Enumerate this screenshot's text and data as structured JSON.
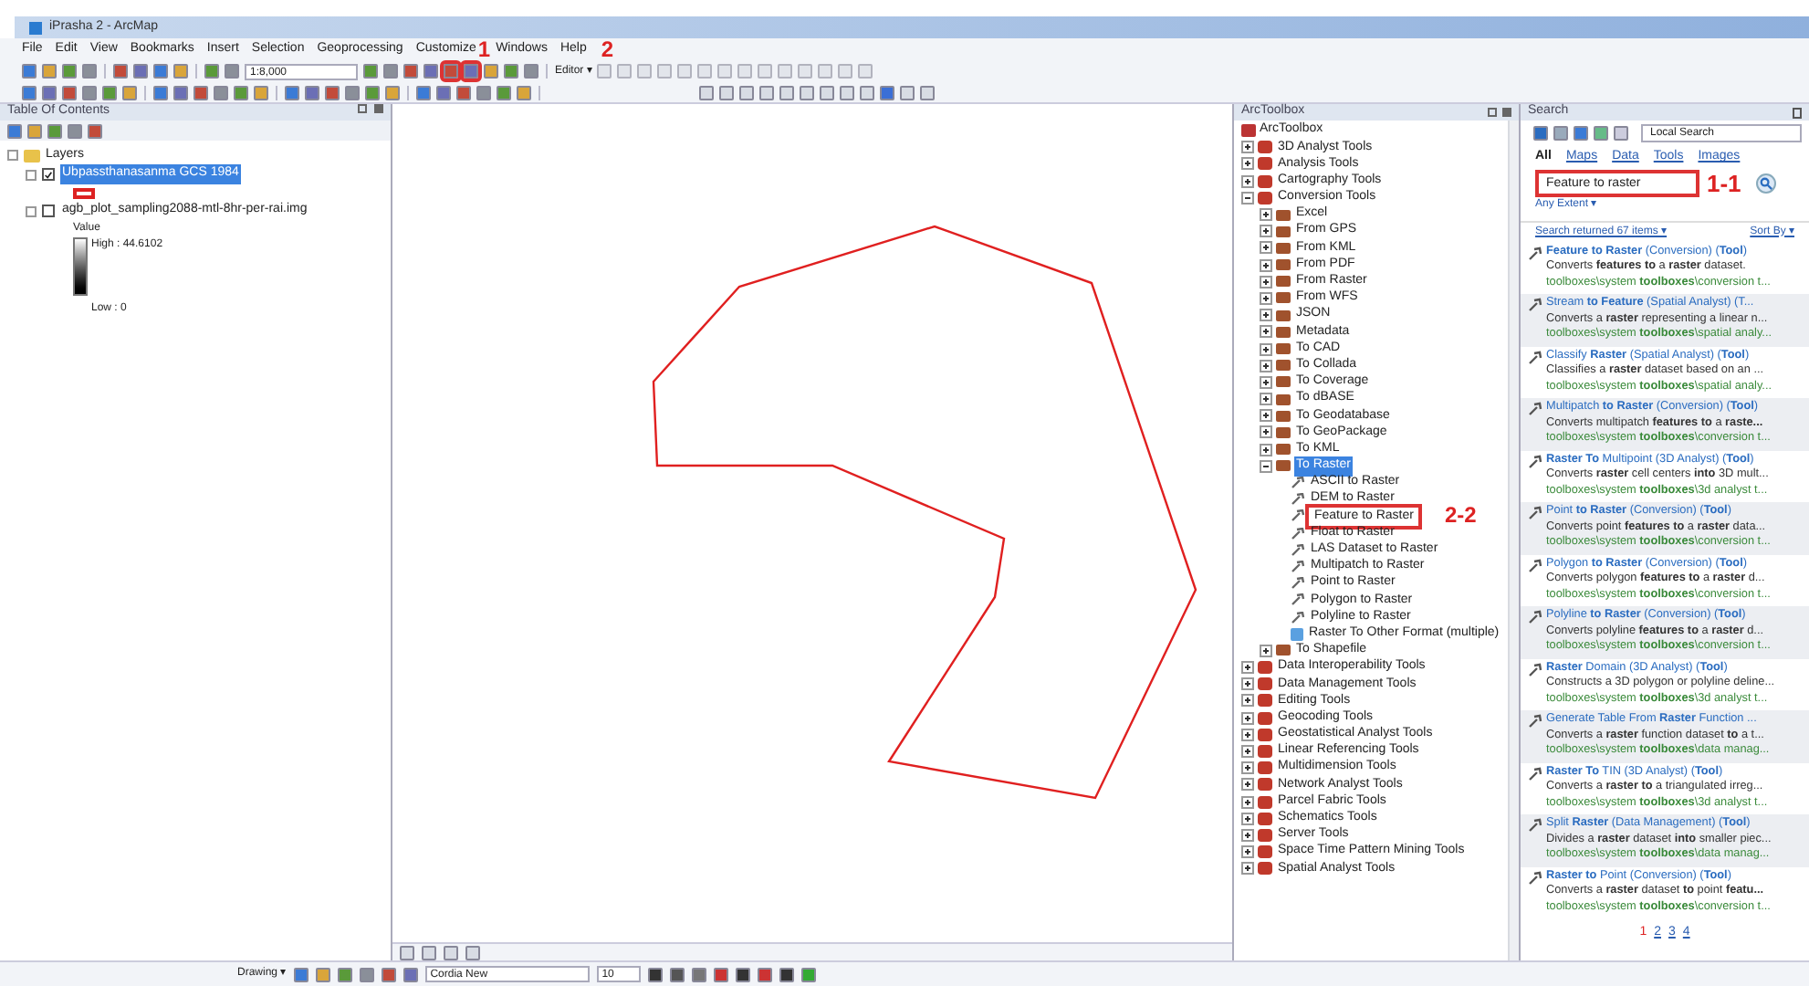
{
  "window": {
    "title": "iPrasha 2 - ArcMap"
  },
  "menu": [
    {
      "label": "File"
    },
    {
      "label": "Edit"
    },
    {
      "label": "View"
    },
    {
      "label": "Bookmarks"
    },
    {
      "label": "Insert"
    },
    {
      "label": "Selection"
    },
    {
      "label": "Geoprocessing"
    },
    {
      "label": "Customize"
    },
    {
      "label": "Windows"
    },
    {
      "label": "Help"
    }
  ],
  "toolbar": {
    "scale": "1:8,000",
    "editor": "Editor ▾"
  },
  "annotations": [
    {
      "text": "1"
    },
    {
      "text": "2"
    },
    {
      "text": "1-1"
    },
    {
      "text": "2-2"
    }
  ],
  "toc": {
    "title": "Table Of Contents",
    "root": "Layers",
    "layers": [
      {
        "name": "Ubpassthanasanma GCS 1984",
        "checked": true,
        "selected": true,
        "kind": "polygon"
      },
      {
        "name": "agb_plot_sampling2088-mtl-8hr-per-rai.img",
        "checked": false,
        "selected": false,
        "kind": "raster",
        "legend_title": "Value",
        "high": "High : 44.6102",
        "low": "Low : 0"
      }
    ]
  },
  "arctoolbox": {
    "title": "ArcToolbox",
    "root": "ArcToolbox",
    "items": [
      {
        "label": "3D Analyst Tools",
        "kind": "toolbox",
        "expanded": false,
        "selected": false
      },
      {
        "label": "Analysis Tools",
        "kind": "toolbox",
        "expanded": false,
        "selected": false
      },
      {
        "label": "Cartography Tools",
        "kind": "toolbox",
        "expanded": false,
        "selected": false
      },
      {
        "label": "Conversion Tools",
        "kind": "toolbox",
        "expanded": true,
        "selected": false,
        "children": [
          {
            "label": "Excel",
            "kind": "toolset",
            "expanded": false,
            "selected": false
          },
          {
            "label": "From GPS",
            "kind": "toolset",
            "expanded": false,
            "selected": false
          },
          {
            "label": "From KML",
            "kind": "toolset",
            "expanded": false,
            "selected": false
          },
          {
            "label": "From PDF",
            "kind": "toolset",
            "expanded": false,
            "selected": false
          },
          {
            "label": "From Raster",
            "kind": "toolset",
            "expanded": false,
            "selected": false
          },
          {
            "label": "From WFS",
            "kind": "toolset",
            "expanded": false,
            "selected": false
          },
          {
            "label": "JSON",
            "kind": "toolset",
            "expanded": false,
            "selected": false
          },
          {
            "label": "Metadata",
            "kind": "toolset",
            "expanded": false,
            "selected": false
          },
          {
            "label": "To CAD",
            "kind": "toolset",
            "expanded": false,
            "selected": false
          },
          {
            "label": "To Collada",
            "kind": "toolset",
            "expanded": false,
            "selected": false
          },
          {
            "label": "To Coverage",
            "kind": "toolset",
            "expanded": false,
            "selected": false
          },
          {
            "label": "To dBASE",
            "kind": "toolset",
            "expanded": false,
            "selected": false
          },
          {
            "label": "To Geodatabase",
            "kind": "toolset",
            "expanded": false,
            "selected": false
          },
          {
            "label": "To GeoPackage",
            "kind": "toolset",
            "expanded": false,
            "selected": false
          },
          {
            "label": "To KML",
            "kind": "toolset",
            "expanded": false,
            "selected": false
          },
          {
            "label": "To Raster",
            "kind": "toolset",
            "expanded": true,
            "selected": true,
            "children": [
              {
                "label": "ASCII to Raster",
                "kind": "tool",
                "selected": false,
                "marked": false
              },
              {
                "label": "DEM to Raster",
                "kind": "tool",
                "selected": false,
                "marked": false
              },
              {
                "label": "Feature to Raster",
                "kind": "tool",
                "selected": false,
                "marked": true
              },
              {
                "label": "Float to Raster",
                "kind": "tool",
                "selected": false,
                "marked": false
              },
              {
                "label": "LAS Dataset to Raster",
                "kind": "tool",
                "selected": false,
                "marked": false
              },
              {
                "label": "Multipatch to Raster",
                "kind": "tool",
                "selected": false,
                "marked": false
              },
              {
                "label": "Point to Raster",
                "kind": "tool",
                "selected": false,
                "marked": false
              },
              {
                "label": "Polygon to Raster",
                "kind": "tool",
                "selected": false,
                "marked": false
              },
              {
                "label": "Polyline to Raster",
                "kind": "tool",
                "selected": false,
                "marked": false
              },
              {
                "label": "Raster To Other Format (multiple)",
                "kind": "script",
                "selected": false,
                "marked": false
              }
            ]
          },
          {
            "label": "To Shapefile",
            "kind": "toolset",
            "expanded": false,
            "selected": false
          }
        ]
      },
      {
        "label": "Data Interoperability Tools",
        "kind": "toolbox",
        "expanded": false,
        "selected": false
      },
      {
        "label": "Data Management Tools",
        "kind": "toolbox",
        "expanded": false,
        "selected": false
      },
      {
        "label": "Editing Tools",
        "kind": "toolbox",
        "expanded": false,
        "selected": false
      },
      {
        "label": "Geocoding Tools",
        "kind": "toolbox",
        "expanded": false,
        "selected": false
      },
      {
        "label": "Geostatistical Analyst Tools",
        "kind": "toolbox",
        "expanded": false,
        "selected": false
      },
      {
        "label": "Linear Referencing Tools",
        "kind": "toolbox",
        "expanded": false,
        "selected": false
      },
      {
        "label": "Multidimension Tools",
        "kind": "toolbox",
        "expanded": false,
        "selected": false
      },
      {
        "label": "Network Analyst Tools",
        "kind": "toolbox",
        "expanded": false,
        "selected": false
      },
      {
        "label": "Parcel Fabric Tools",
        "kind": "toolbox",
        "expanded": false,
        "selected": false
      },
      {
        "label": "Schematics Tools",
        "kind": "toolbox",
        "expanded": false,
        "selected": false
      },
      {
        "label": "Server Tools",
        "kind": "toolbox",
        "expanded": false,
        "selected": false
      },
      {
        "label": "Space Time Pattern Mining Tools",
        "kind": "toolbox",
        "expanded": false,
        "selected": false
      },
      {
        "label": "Spatial Analyst Tools",
        "kind": "toolbox",
        "expanded": false,
        "selected": false
      }
    ]
  },
  "search": {
    "title": "Search",
    "scope": "Local Search",
    "tabs": [
      {
        "label": "All",
        "selected": true
      },
      {
        "label": "Maps",
        "selected": false
      },
      {
        "label": "Data",
        "selected": false
      },
      {
        "label": "Tools",
        "selected": false
      },
      {
        "label": "Images",
        "selected": false
      }
    ],
    "query": "Feature to raster",
    "extent": "Any Extent ▾",
    "count": "Search returned 67 items ▾",
    "sort": "Sort By ▾",
    "results": [
      {
        "title": "**Feature to Raster** (Conversion) (**Tool**)",
        "description": "Converts **features to** a **raster** dataset.",
        "path": "toolboxes\\system **toolboxes**\\conversion t..."
      },
      {
        "title": "Stream **to Feature** (Spatial Analyst) (T...",
        "description": "Converts a **raster** representing a linear n...",
        "path": "toolboxes\\system **toolboxes**\\spatial analy..."
      },
      {
        "title": "Classify **Raster** (Spatial Analyst) (**Tool**)",
        "description": "Classifies a **raster** dataset based on an ...",
        "path": "toolboxes\\system **toolboxes**\\spatial analy..."
      },
      {
        "title": "Multipatch **to Raster** (Conversion) (**Tool**)",
        "description": "Converts multipatch **features to** a **raste...**",
        "path": "toolboxes\\system **toolboxes**\\conversion t..."
      },
      {
        "title": "**Raster To** Multipoint (3D Analyst) (**Tool**)",
        "description": "Converts **raster** cell centers **into** 3D mult...",
        "path": "toolboxes\\system **toolboxes**\\3d analyst t..."
      },
      {
        "title": "Point **to Raster** (Conversion) (**Tool**)",
        "description": "Converts point **features to** a **raster** data...",
        "path": "toolboxes\\system **toolboxes**\\conversion t..."
      },
      {
        "title": "Polygon **to Raster** (Conversion) (**Tool**)",
        "description": "Converts polygon **features to** a **raster** d...",
        "path": "toolboxes\\system **toolboxes**\\conversion t..."
      },
      {
        "title": "Polyline **to Raster** (Conversion) (**Tool**)",
        "description": "Converts polyline **features to** a **raster** d...",
        "path": "toolboxes\\system **toolboxes**\\conversion t..."
      },
      {
        "title": "**Raster** Domain (3D Analyst) (**Tool**)",
        "description": "Constructs a 3D polygon or polyline deline...",
        "path": "toolboxes\\system **toolboxes**\\3d analyst t..."
      },
      {
        "title": "Generate Table From **Raster** Function ...",
        "description": "Converts a **raster** function dataset **to** a t...",
        "path": "toolboxes\\system **toolboxes**\\data manag..."
      },
      {
        "title": "**Raster To** TIN (3D Analyst) (**Tool**)",
        "description": "Converts a **raster to** a triangulated irreg...",
        "path": "toolboxes\\system **toolboxes**\\3d analyst t..."
      },
      {
        "title": "Split **Raster** (Data Management) (**Tool**)",
        "description": "Divides a **raster** dataset **into** smaller piec...",
        "path": "toolboxes\\system **toolboxes**\\data manag..."
      },
      {
        "title": "**Raster to** Point (Conversion) (**Tool**)",
        "description": "Converts a **raster** dataset **to** point **featu...**",
        "path": "toolboxes\\system **toolboxes**\\conversion t..."
      }
    ],
    "pages": [
      {
        "label": "1",
        "selected": true
      },
      {
        "label": "2",
        "selected": false
      },
      {
        "label": "3",
        "selected": false
      },
      {
        "label": "4",
        "selected": false
      }
    ]
  },
  "drawing_toolbar": {
    "drawing": "Drawing ▾",
    "font": "Cordia New",
    "size": "10"
  }
}
